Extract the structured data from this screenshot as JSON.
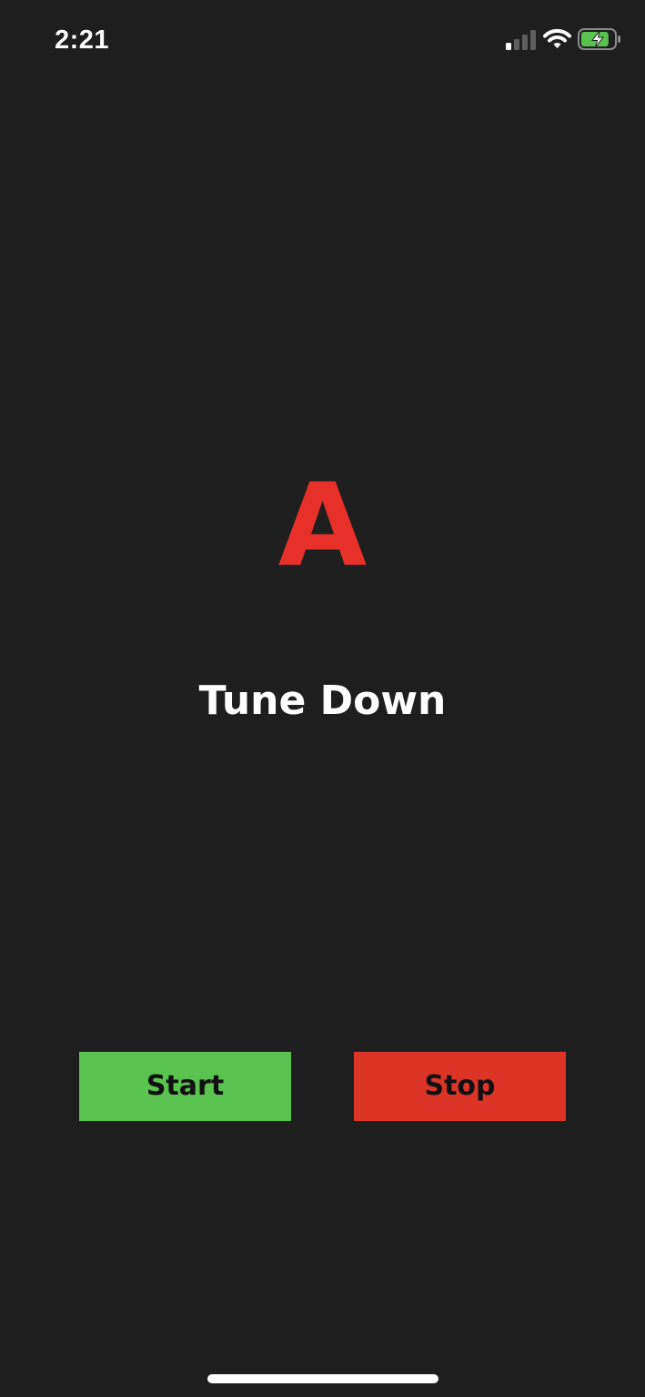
{
  "status_bar": {
    "time": "2:21",
    "signal_icon": "cellular-signal-icon",
    "signal_bars_active": 1,
    "signal_bars_total": 4,
    "wifi_icon": "wifi-icon",
    "battery_icon": "battery-charging-icon",
    "battery_level": 0.85
  },
  "tuner": {
    "note": "A",
    "instruction": "Tune Down"
  },
  "controls": {
    "start_label": "Start",
    "stop_label": "Stop"
  },
  "colors": {
    "background": "#1e1e1e",
    "note": "#e8302a",
    "start_button": "#5ac34f",
    "stop_button": "#dd3428",
    "battery_fill": "#5ac34f"
  }
}
